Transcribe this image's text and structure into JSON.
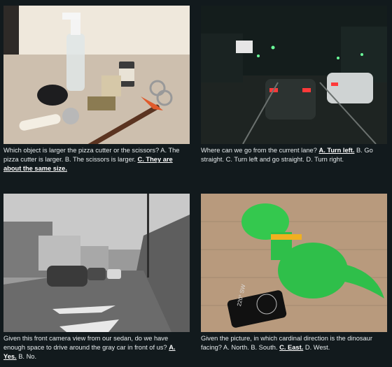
{
  "cards": [
    {
      "image_alt": "objects on a table",
      "question": "Which object is larger the pizza cutter or the scissors? A. The pizza cutter is larger. B. The scissors is larger.",
      "answer": "C. They are about the same size.",
      "rest": ""
    },
    {
      "image_alt": "night street view",
      "question": "Where can we go from the current lane?",
      "answer": "A. Turn left.",
      "rest": "B. Go straight. C. Turn left and go straight. D. Turn right."
    },
    {
      "image_alt": "front camera street view",
      "question": "Given this front camera view from our sedan, do we have enough space to drive around the gray car in front of us?",
      "answer": "A. Yes.",
      "rest": "B. No."
    },
    {
      "image_alt": "dinosaur toy and compass",
      "question": "Given the picture, in which cardinal direction is the dinosaur facing? A. North. B. South.",
      "answer": "C. East.",
      "rest": "D. West."
    }
  ],
  "compass_readout": "220° SW"
}
